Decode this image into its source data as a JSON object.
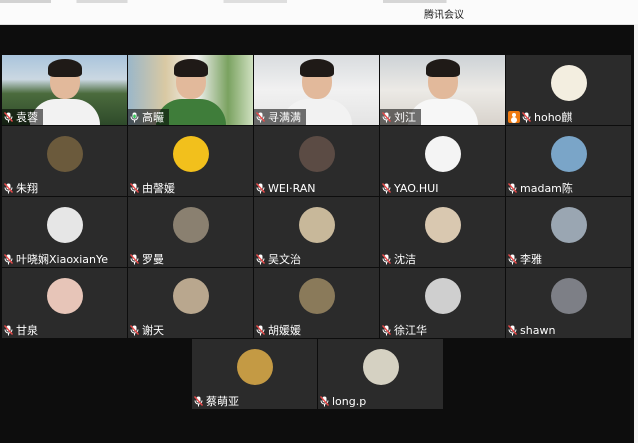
{
  "window": {
    "title": "腾讯会议"
  },
  "colors": {
    "accent_orange": "#f07a10",
    "mic_muted_red": "#e84a4a",
    "mic_active_green": "#34c759",
    "tile_bg": "#2b2b2b",
    "stage_bg": "#0d0d0d"
  },
  "participants": [
    {
      "name": "袁蓉",
      "mic": "muted",
      "tile": "video"
    },
    {
      "name": "高曮",
      "mic": "active",
      "tile": "video"
    },
    {
      "name": "寻满满",
      "mic": "muted",
      "tile": "video"
    },
    {
      "name": "刘江",
      "mic": "muted",
      "tile": "video"
    },
    {
      "name": "hoho麒",
      "mic": "muted",
      "tile": "avatar",
      "host": true
    },
    {
      "name": "朱翔",
      "mic": "muted",
      "tile": "avatar"
    },
    {
      "name": "由謦媛",
      "mic": "muted",
      "tile": "avatar"
    },
    {
      "name": "WEI·RAN",
      "mic": "muted",
      "tile": "avatar"
    },
    {
      "name": "YAO.HUI",
      "mic": "muted",
      "tile": "avatar"
    },
    {
      "name": "madam陈",
      "mic": "muted",
      "tile": "avatar"
    },
    {
      "name": "叶晓娴XiaoxianYe",
      "mic": "muted",
      "tile": "avatar"
    },
    {
      "name": "罗曼",
      "mic": "muted",
      "tile": "avatar"
    },
    {
      "name": "吴文治",
      "mic": "muted",
      "tile": "avatar"
    },
    {
      "name": "沈洁",
      "mic": "muted",
      "tile": "avatar"
    },
    {
      "name": "李雅",
      "mic": "muted",
      "tile": "avatar"
    },
    {
      "name": "甘泉",
      "mic": "muted",
      "tile": "avatar"
    },
    {
      "name": "谢天",
      "mic": "muted",
      "tile": "avatar"
    },
    {
      "name": "胡媛媛",
      "mic": "muted",
      "tile": "avatar"
    },
    {
      "name": "徐江华",
      "mic": "muted",
      "tile": "avatar"
    },
    {
      "name": "shawn",
      "mic": "muted",
      "tile": "avatar"
    },
    {
      "name": "蔡萌亚",
      "mic": "muted",
      "tile": "avatar"
    },
    {
      "name": "long.p",
      "mic": "muted",
      "tile": "avatar"
    }
  ]
}
